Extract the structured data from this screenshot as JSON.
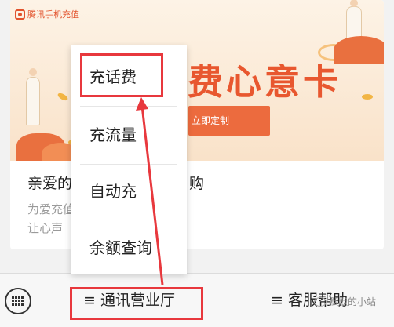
{
  "banner": {
    "brand": "腾讯手机充值",
    "headline": "费心意卡",
    "cta": "立即定制"
  },
  "card": {
    "title_start": "亲爱的",
    "title_end": "购",
    "desc_line1": "为爱充值",
    "desc_line2": "让心声"
  },
  "menu": {
    "items": [
      {
        "label": "充话费"
      },
      {
        "label": "充流量"
      },
      {
        "label": "自动充"
      },
      {
        "label": "余额查询"
      }
    ]
  },
  "bottom_bar": {
    "keyboard_icon": "keyboard-icon",
    "menu1": "≡ 通讯营业厅",
    "menu2": "≡ 客服帮助",
    "watermark": "默默的小站"
  },
  "colors": {
    "accent": "#e8572f",
    "highlight": "#e8383d"
  }
}
